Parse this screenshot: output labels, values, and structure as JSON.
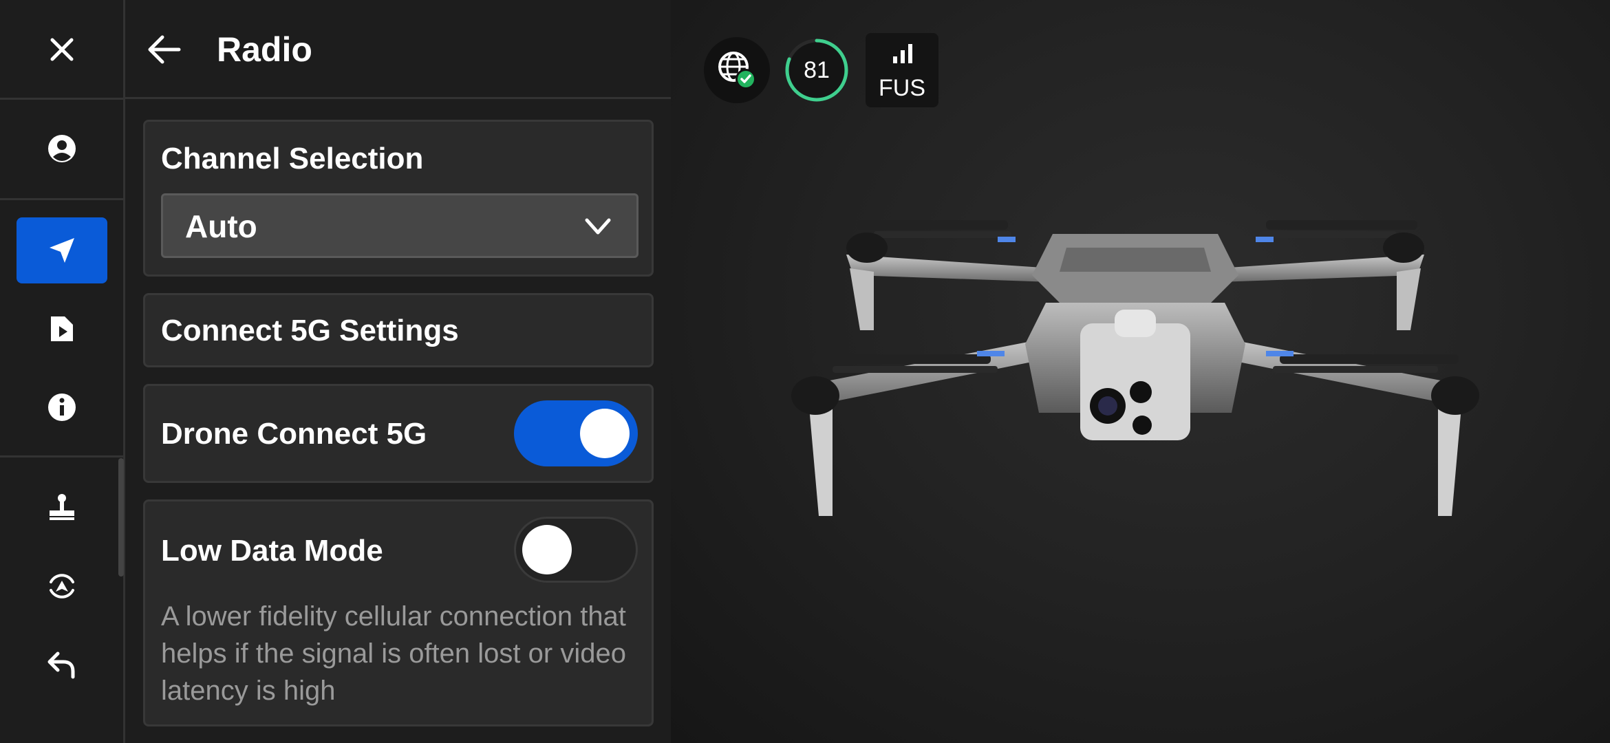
{
  "panel": {
    "title": "Radio"
  },
  "channel_selection": {
    "label": "Channel Selection",
    "selected": "Auto"
  },
  "connect_5g_settings": {
    "label": "Connect 5G Settings"
  },
  "drone_connect_5g": {
    "label": "Drone Connect 5G",
    "enabled": true
  },
  "low_data_mode": {
    "label": "Low Data Mode",
    "enabled": false,
    "description": "A lower fidelity cellular connection that helps if the signal is often lost or video latency is high"
  },
  "status": {
    "battery": "81",
    "battery_level": 0.81,
    "signal_label": "FUS"
  },
  "colors": {
    "accent": "#0a5bd8",
    "battery_ring": "#3fcf8e",
    "check": "#22b35e"
  },
  "icons": {
    "rail": [
      "close-icon",
      "account-icon",
      "navigation-arrow-icon",
      "media-files-icon",
      "info-icon",
      "joystick-icon",
      "drone-orbit-icon",
      "return-home-icon"
    ]
  }
}
